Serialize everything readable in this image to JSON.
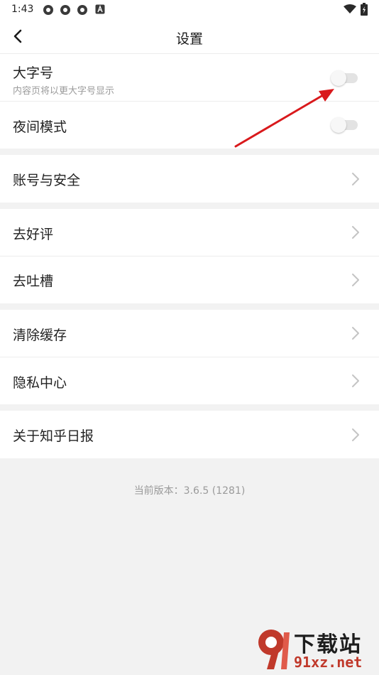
{
  "status_bar": {
    "time": "1:43",
    "left_icons": [
      "gear-notification-icon",
      "gear-notification-icon",
      "gear-notification-icon",
      "a-notification-icon"
    ],
    "right_icons": [
      "wifi-icon",
      "battery-icon"
    ]
  },
  "header": {
    "title": "设置"
  },
  "groups": {
    "display": {
      "large_font": {
        "label": "大字号",
        "sublabel": "内容页将以更大字号显示",
        "enabled": false
      },
      "night_mode": {
        "label": "夜间模式",
        "enabled": false
      }
    },
    "account": {
      "account_security": "账号与安全"
    },
    "feedback": {
      "rate": "去好评",
      "complain": "去吐槽"
    },
    "privacy": {
      "clear_cache": "清除缓存",
      "privacy_center": "隐私中心"
    },
    "about": {
      "about_app": "关于知乎日报"
    }
  },
  "version_text": "当前版本：3.6.5 (1281)",
  "annotation": {
    "arrow_color": "#d9191c"
  },
  "watermark": {
    "top_text": "下载站",
    "bottom_text": "91xz.net",
    "color": "#c0392b"
  }
}
